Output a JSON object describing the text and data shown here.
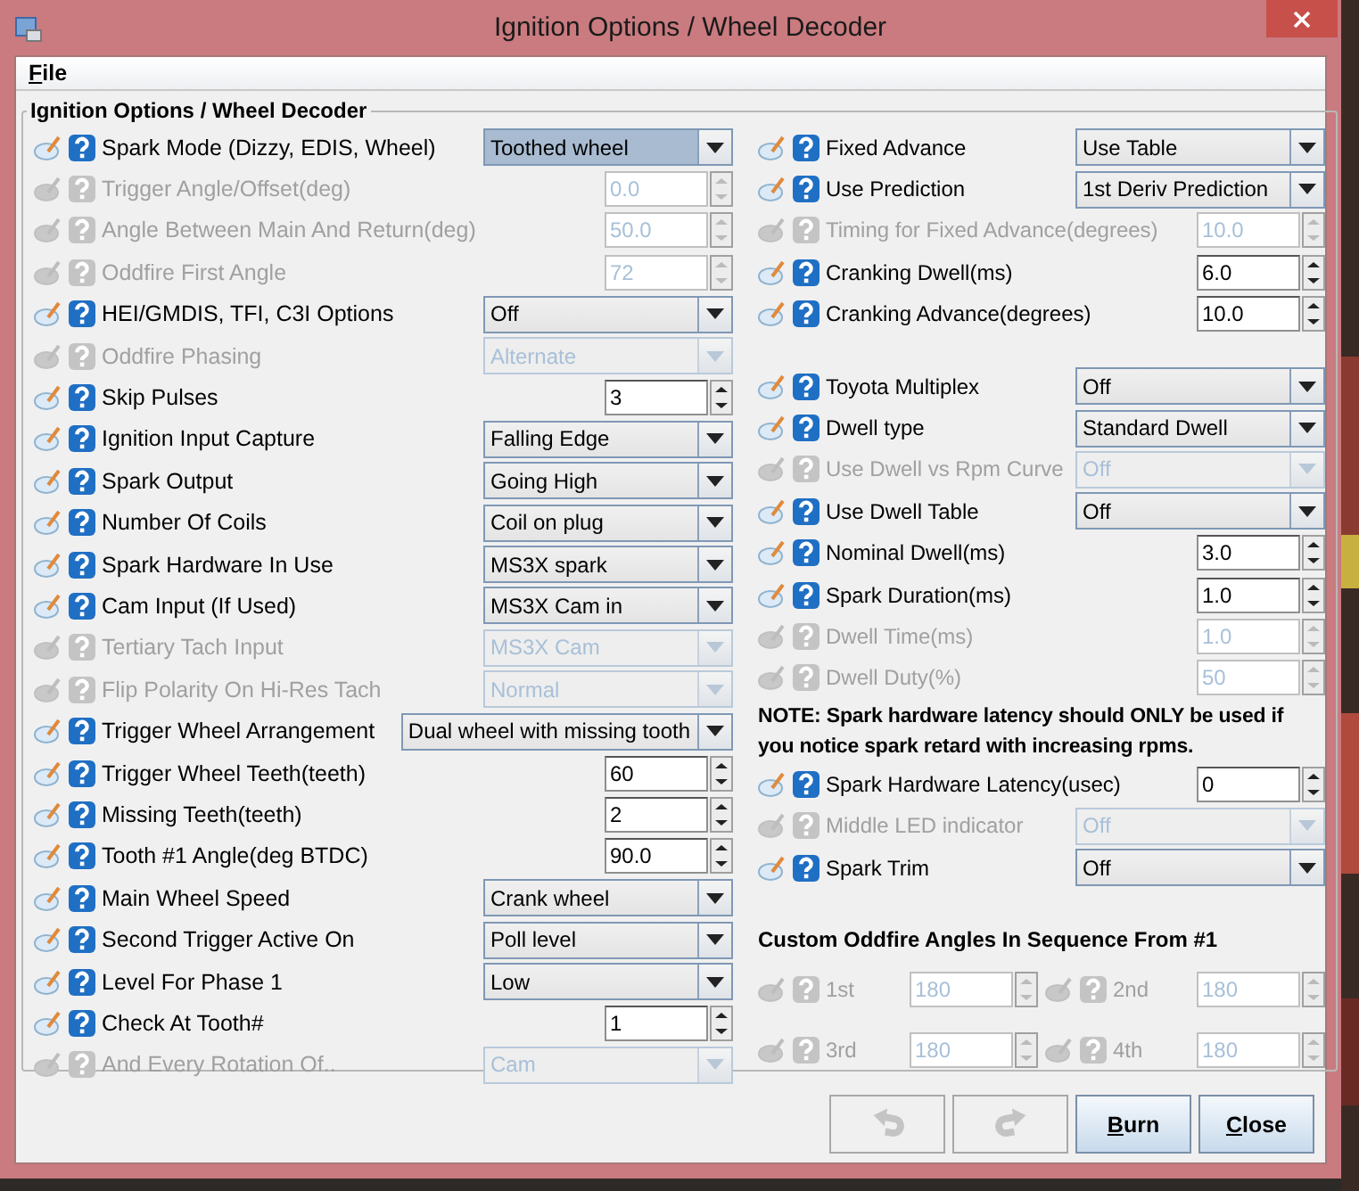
{
  "window": {
    "title": "Ignition Options / Wheel Decoder"
  },
  "menu": [
    {
      "label": "File"
    }
  ],
  "group_title": "Ignition Options / Wheel Decoder",
  "left_rows": [
    {
      "label": "Spark Mode (Dizzy, EDIS, Wheel)",
      "kind": "combo",
      "value": "Toothed wheel",
      "disabled": false,
      "focused": true
    },
    {
      "label": "Trigger Angle/Offset(deg)",
      "kind": "spinner",
      "value": "0.0",
      "disabled": true,
      "focused": false
    },
    {
      "label": "Angle Between Main And Return(deg)",
      "kind": "spinner",
      "value": "50.0",
      "disabled": true,
      "focused": false
    },
    {
      "label": "Oddfire First Angle",
      "kind": "spinner",
      "value": "72",
      "disabled": true,
      "focused": false
    },
    {
      "label": "HEI/GMDIS, TFI, C3I Options",
      "kind": "combo",
      "value": "Off",
      "disabled": false,
      "focused": false
    },
    {
      "label": "Oddfire Phasing",
      "kind": "combo",
      "value": "Alternate",
      "disabled": true,
      "focused": false
    },
    {
      "label": "Skip Pulses",
      "kind": "spinner",
      "value": "3",
      "disabled": false,
      "focused": false
    },
    {
      "label": "Ignition Input Capture",
      "kind": "combo",
      "value": "Falling Edge",
      "disabled": false,
      "focused": false
    },
    {
      "label": "Spark Output",
      "kind": "combo",
      "value": "Going High",
      "disabled": false,
      "focused": false
    },
    {
      "label": "Number Of Coils",
      "kind": "combo",
      "value": "Coil on plug",
      "disabled": false,
      "focused": false
    },
    {
      "label": "Spark Hardware In Use",
      "kind": "combo",
      "value": "MS3X spark",
      "disabled": false,
      "focused": false
    },
    {
      "label": "Cam Input (If Used)",
      "kind": "combo",
      "value": "MS3X Cam in",
      "disabled": false,
      "focused": false
    },
    {
      "label": "Tertiary Tach Input",
      "kind": "combo",
      "value": "MS3X Cam",
      "disabled": true,
      "focused": false
    },
    {
      "label": "Flip Polarity On Hi-Res Tach",
      "kind": "combo",
      "value": "Normal",
      "disabled": true,
      "focused": false
    },
    {
      "label": "Trigger Wheel Arrangement",
      "kind": "combo",
      "value": "Dual wheel with missing tooth",
      "disabled": false,
      "focused": false
    },
    {
      "label": "Trigger Wheel Teeth(teeth)",
      "kind": "spinner",
      "value": "60",
      "disabled": false,
      "focused": false
    },
    {
      "label": "Missing Teeth(teeth)",
      "kind": "spinner",
      "value": "2",
      "disabled": false,
      "focused": false
    },
    {
      "label": "Tooth #1 Angle(deg BTDC)",
      "kind": "spinner",
      "value": "90.0",
      "disabled": false,
      "focused": false
    },
    {
      "label": "Main Wheel Speed",
      "kind": "combo",
      "value": "Crank wheel",
      "disabled": false,
      "focused": false
    },
    {
      "label": "Second Trigger Active On",
      "kind": "combo",
      "value": "Poll level",
      "disabled": false,
      "focused": false
    },
    {
      "label": "Level For Phase 1",
      "kind": "combo",
      "value": "Low",
      "disabled": false,
      "focused": false
    },
    {
      "label": "Check At Tooth#",
      "kind": "spinner",
      "value": "1",
      "disabled": false,
      "focused": false
    },
    {
      "label": "And Every Rotation Of..",
      "kind": "combo",
      "value": "Cam",
      "disabled": true,
      "focused": false
    }
  ],
  "right_top_rows": [
    {
      "label": "Fixed Advance",
      "kind": "combo",
      "value": "Use Table",
      "disabled": false,
      "focused": false
    },
    {
      "label": "Use Prediction",
      "kind": "combo",
      "value": "1st Deriv Prediction",
      "disabled": false,
      "focused": false
    },
    {
      "label": "Timing for Fixed Advance(degrees)",
      "kind": "spinner",
      "value": "10.0",
      "disabled": true,
      "focused": false
    },
    {
      "label": "Cranking Dwell(ms)",
      "kind": "spinner",
      "value": "6.0",
      "disabled": false,
      "focused": false
    },
    {
      "label": "Cranking Advance(degrees)",
      "kind": "spinner",
      "value": "10.0",
      "disabled": false,
      "focused": false
    }
  ],
  "right_mid_rows": [
    {
      "label": "Toyota Multiplex",
      "kind": "combo",
      "value": "Off",
      "disabled": false,
      "focused": false
    },
    {
      "label": "Dwell type",
      "kind": "combo",
      "value": "Standard Dwell",
      "disabled": false,
      "focused": false
    },
    {
      "label": "Use Dwell vs Rpm Curve",
      "kind": "combo",
      "value": "Off",
      "disabled": true,
      "focused": false
    },
    {
      "label": "Use Dwell Table",
      "kind": "combo",
      "value": "Off",
      "disabled": false,
      "focused": false
    },
    {
      "label": "Nominal Dwell(ms)",
      "kind": "spinner",
      "value": "3.0",
      "disabled": false,
      "focused": false
    },
    {
      "label": "Spark Duration(ms)",
      "kind": "spinner",
      "value": "1.0",
      "disabled": false,
      "focused": false
    },
    {
      "label": "Dwell Time(ms)",
      "kind": "spinner",
      "value": "1.0",
      "disabled": true,
      "focused": false
    },
    {
      "label": "Dwell Duty(%)",
      "kind": "spinner",
      "value": "50",
      "disabled": true,
      "focused": false
    }
  ],
  "note": "NOTE: Spark hardware latency should ONLY be used if you notice spark retard with increasing rpms.",
  "right_bottom_rows": [
    {
      "label": "Spark Hardware Latency(usec)",
      "kind": "spinner",
      "value": "0",
      "disabled": false,
      "focused": false
    },
    {
      "label": "Middle LED indicator",
      "kind": "combo",
      "value": "Off",
      "disabled": true,
      "focused": false
    },
    {
      "label": "Spark Trim",
      "kind": "combo",
      "value": "Off",
      "disabled": false,
      "focused": false
    }
  ],
  "oddfire": {
    "title": "Custom Oddfire Angles In Sequence From #1",
    "angles": [
      {
        "label": "1st",
        "value": "180",
        "disabled": true,
        "focused": false
      },
      {
        "label": "2nd",
        "value": "180",
        "disabled": true,
        "focused": false
      },
      {
        "label": "3rd",
        "value": "180",
        "disabled": true,
        "focused": false
      },
      {
        "label": "4th",
        "value": "180",
        "disabled": true,
        "focused": false
      }
    ]
  },
  "buttons": [
    {
      "kind": "undo",
      "disabled": true
    },
    {
      "kind": "redo",
      "disabled": true
    },
    {
      "kind": "text",
      "label": "Burn",
      "disabled": false
    },
    {
      "kind": "text",
      "label": "Close",
      "disabled": false
    }
  ]
}
